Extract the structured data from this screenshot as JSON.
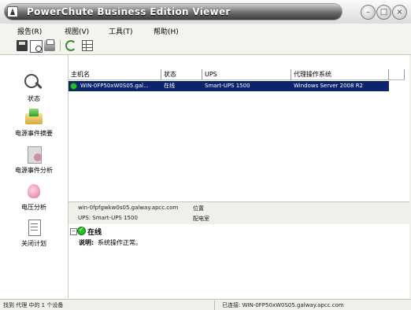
{
  "window": {
    "title": "PowerChute Business Edition Viewer",
    "buttons": {
      "minimize": "–",
      "maximize": "□",
      "close": "×"
    }
  },
  "menu": [
    "报告(R)",
    "视图(V)",
    "工具(T)",
    "帮助(H)"
  ],
  "toolbar": {
    "icons": [
      "save-icon",
      "print-preview-icon",
      "print-icon",
      "refresh-icon",
      "grid-icon"
    ]
  },
  "sidebar": {
    "items": [
      {
        "label": "状态",
        "icon": "status-magnifier-icon"
      },
      {
        "label": "电源事件摘要",
        "icon": "event-summary-icon"
      },
      {
        "label": "电源事件分析",
        "icon": "event-analysis-icon"
      },
      {
        "label": "电压分析",
        "icon": "voltage-icon"
      },
      {
        "label": "关闭计划",
        "icon": "schedule-icon"
      }
    ]
  },
  "list": {
    "columns": [
      "主机名",
      "状态",
      "UPS",
      "代理操作系统"
    ],
    "rows": [
      {
        "host": "WIN-0FP50xW0S05.gal...",
        "status": "在线",
        "ups": "Smart-UPS 1500",
        "os": "Windows Server 2008 R2"
      }
    ]
  },
  "detail_header": {
    "host": "win-0fpfgwkw0s05.galway.apcc.com",
    "location_label": "位置",
    "ups": "UPS: Smart-UPS 1500",
    "location_value": "配电室"
  },
  "detail": {
    "toggle": "−",
    "title": "在线",
    "desc_key": "说明:",
    "desc_val": "系统操作正常。"
  },
  "statusbar": {
    "left": "找到 代理 中的 1 个设备",
    "right": "已连接: WIN-0FP50xW0S05.galway.apcc.com"
  },
  "colors": {
    "selection": "#0b246a",
    "online_green": "#2bbd2b",
    "title_dark": "#3e3e3e"
  }
}
